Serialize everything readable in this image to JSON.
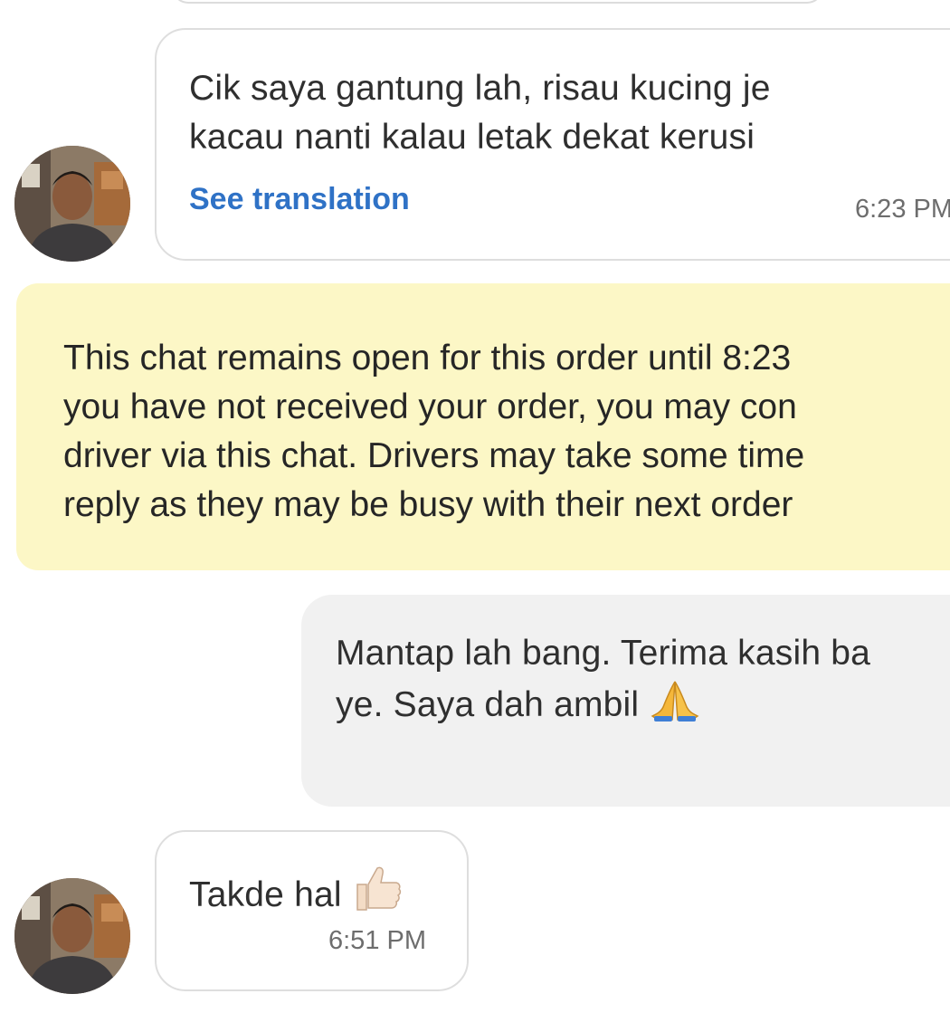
{
  "messages": {
    "incoming_1": {
      "line1": "Cik saya gantung lah, risau kucing je",
      "line2": "kacau nanti kalau letak dekat kerusi",
      "translate_label": "See translation",
      "time": "6:23 PM"
    },
    "notice": {
      "line1": "This chat remains open for this order until 8:23",
      "line2": "you have not received your order, you may con",
      "line3": "driver via this chat. Drivers may take some time",
      "line4": "reply as they may be busy with their next order"
    },
    "outgoing_1": {
      "line1": "Mantap lah bang. Terima kasih ba",
      "line2": "ye. Saya dah ambil",
      "emoji": "folded-hands-icon"
    },
    "incoming_2": {
      "text": "Takde hal",
      "emoji": "thumbs-up-icon",
      "time": "6:51 PM"
    }
  },
  "colors": {
    "link": "#2f72c6",
    "notice_bg": "#fcf7c6",
    "outgoing_bg": "#f1f1f1",
    "incoming_border": "#dedede"
  }
}
